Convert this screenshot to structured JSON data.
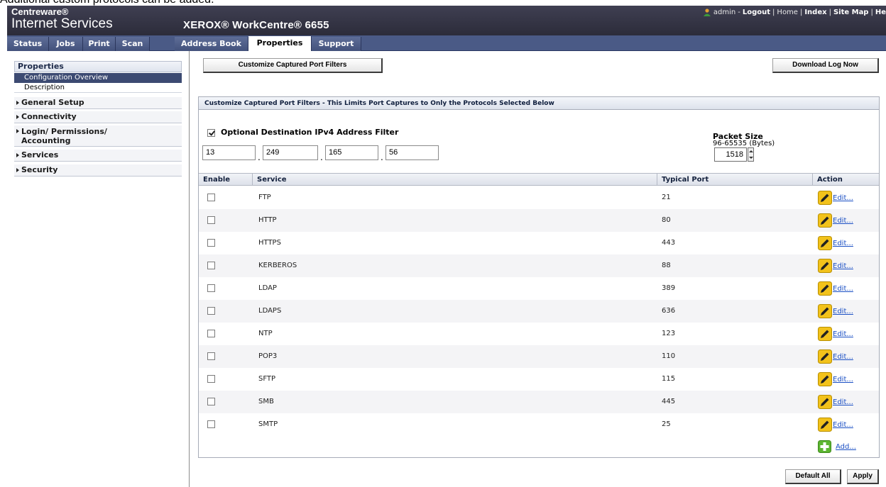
{
  "caption": "Additional custom protocols can be added.",
  "header": {
    "brand_top": "Centreware®",
    "brand_bottom": "Internet Services",
    "device": "XEROX® WorkCentre® 6655",
    "user": "admin",
    "links": [
      "Logout",
      "Home",
      "Index",
      "Site Map",
      "He"
    ]
  },
  "tabs": [
    {
      "label": "Status"
    },
    {
      "label": "Jobs"
    },
    {
      "label": "Print"
    },
    {
      "label": "Scan"
    },
    {
      "label": "Address Book"
    },
    {
      "label": "Properties"
    },
    {
      "label": "Support"
    }
  ],
  "sidebar": {
    "title": "Properties",
    "selected": "Configuration Overview",
    "description": "Description",
    "groups": [
      "General Setup",
      "Connectivity",
      "Login/ Permissions/ Accounting",
      "Services",
      "Security"
    ]
  },
  "buttons": {
    "customize": "Customize Captured Port Filters",
    "download": "Download Log Now",
    "default_all": "Default All",
    "apply": "Apply"
  },
  "panel": {
    "title": "Customize Captured Port Filters - This Limits Port Captures to Only the Protocols Selected Below",
    "filter_label": "Optional Destination IPv4 Address Filter",
    "filter_checked": true,
    "ip": [
      "13",
      "249",
      "165",
      "56"
    ],
    "packet_size_label": "Packet Size",
    "packet_size_range": "96-65535 (Bytes)",
    "packet_size": "1518"
  },
  "table": {
    "headers": {
      "enable": "Enable",
      "service": "Service",
      "port": "Typical Port",
      "action": "Action"
    },
    "rows": [
      {
        "service": "FTP",
        "port": "21",
        "enabled": false
      },
      {
        "service": "HTTP",
        "port": "80",
        "enabled": false
      },
      {
        "service": "HTTPS",
        "port": "443",
        "enabled": false
      },
      {
        "service": "KERBEROS",
        "port": "88",
        "enabled": false
      },
      {
        "service": "LDAP",
        "port": "389",
        "enabled": false
      },
      {
        "service": "LDAPS",
        "port": "636",
        "enabled": false
      },
      {
        "service": "NTP",
        "port": "123",
        "enabled": false
      },
      {
        "service": "POP3",
        "port": "110",
        "enabled": false
      },
      {
        "service": "SFTP",
        "port": "115",
        "enabled": false
      },
      {
        "service": "SMB",
        "port": "445",
        "enabled": false
      },
      {
        "service": "SMTP",
        "port": "25",
        "enabled": false
      }
    ],
    "edit_label": "Edit...",
    "add_label": "Add..."
  },
  "colors": {
    "header_bg": "#34344a",
    "tab_bg": "#4a5a86",
    "selected_nav": "#3c4a72",
    "link": "#1a4fc4",
    "edit_icon": "#f2c21b",
    "add_icon": "#5cb531"
  },
  "icons": {
    "user": "user-icon",
    "edit": "pencil-icon",
    "add": "plus-icon",
    "expand": "triangle-right-icon"
  }
}
